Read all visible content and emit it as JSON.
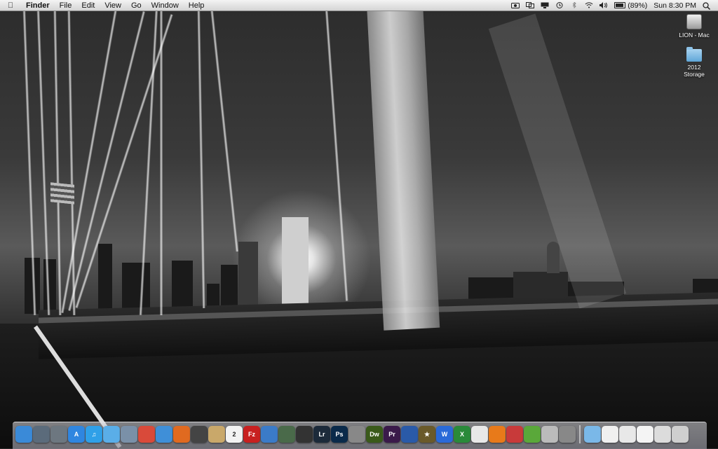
{
  "menubar": {
    "apple_icon": "apple-icon",
    "app_name": "Finder",
    "menus": [
      "File",
      "Edit",
      "View",
      "Go",
      "Window",
      "Help"
    ],
    "battery_text": "(89%)",
    "battery_level": 0.89,
    "clock": "Sun 8:30 PM"
  },
  "desktop_icons": [
    {
      "label_line1": "LION - Mac",
      "label_line2": "",
      "icon": "hard-drive-icon"
    },
    {
      "label_line1": "2012",
      "label_line2": "Storage",
      "icon": "folder-icon"
    }
  ],
  "dock": {
    "items": [
      {
        "name": "finder",
        "icon": "finder-icon",
        "color": "#3a8ad8",
        "glyph": ""
      },
      {
        "name": "dashboard",
        "icon": "dashboard-icon",
        "color": "#5b6b7b",
        "glyph": ""
      },
      {
        "name": "launchpad",
        "icon": "launchpad-icon",
        "color": "#6d7780",
        "glyph": ""
      },
      {
        "name": "app-store",
        "icon": "app-store-icon",
        "color": "#2f86e0",
        "glyph": "A"
      },
      {
        "name": "itunes",
        "icon": "itunes-icon",
        "color": "#2fa0e8",
        "glyph": "♫"
      },
      {
        "name": "messages",
        "icon": "messages-icon",
        "color": "#5aaee8",
        "glyph": ""
      },
      {
        "name": "preview",
        "icon": "preview-icon",
        "color": "#7a90a8",
        "glyph": ""
      },
      {
        "name": "chrome",
        "icon": "chrome-icon",
        "color": "#d94a3a",
        "glyph": ""
      },
      {
        "name": "safari",
        "icon": "safari-icon",
        "color": "#3f8fd8",
        "glyph": ""
      },
      {
        "name": "firefox",
        "icon": "firefox-icon",
        "color": "#e06a20",
        "glyph": ""
      },
      {
        "name": "facetime",
        "icon": "camera-icon",
        "color": "#444",
        "glyph": ""
      },
      {
        "name": "contacts",
        "icon": "address-book-icon",
        "color": "#c9a86a",
        "glyph": ""
      },
      {
        "name": "calendar",
        "icon": "calendar-icon",
        "color": "#f2f2f2",
        "glyph": "2"
      },
      {
        "name": "filezilla",
        "icon": "filezilla-icon",
        "color": "#c82020",
        "glyph": "Fz"
      },
      {
        "name": "world",
        "icon": "globe-icon",
        "color": "#3b7bc8",
        "glyph": ""
      },
      {
        "name": "iphoto",
        "icon": "iphoto-icon",
        "color": "#4a6a4a",
        "glyph": ""
      },
      {
        "name": "aperture",
        "icon": "aperture-icon",
        "color": "#333",
        "glyph": ""
      },
      {
        "name": "lightroom",
        "icon": "lightroom-icon",
        "color": "#1c2a3a",
        "glyph": "Lr"
      },
      {
        "name": "photoshop",
        "icon": "photoshop-icon",
        "color": "#0a2a4a",
        "glyph": "Ps"
      },
      {
        "name": "screenshot",
        "icon": "camera-icon",
        "color": "#888",
        "glyph": ""
      },
      {
        "name": "dreamweaver",
        "icon": "dreamweaver-icon",
        "color": "#3a5a1a",
        "glyph": "Dw"
      },
      {
        "name": "premiere",
        "icon": "premiere-icon",
        "color": "#3a1a4a",
        "glyph": "Pr"
      },
      {
        "name": "quicktime",
        "icon": "quicktime-icon",
        "color": "#2a5aa8",
        "glyph": ""
      },
      {
        "name": "imovie",
        "icon": "star-icon",
        "color": "#6a5a2a",
        "glyph": "★"
      },
      {
        "name": "word",
        "icon": "word-icon",
        "color": "#2a6ad8",
        "glyph": "W"
      },
      {
        "name": "excel",
        "icon": "excel-icon",
        "color": "#2a8a3a",
        "glyph": "X"
      },
      {
        "name": "textedit",
        "icon": "textedit-icon",
        "color": "#e8e8e8",
        "glyph": ""
      },
      {
        "name": "vlc",
        "icon": "vlc-icon",
        "color": "#e87a1a",
        "glyph": ""
      },
      {
        "name": "parallels",
        "icon": "parallels-icon",
        "color": "#c83a3a",
        "glyph": ""
      },
      {
        "name": "activity",
        "icon": "activity-icon",
        "color": "#5aa83a",
        "glyph": ""
      },
      {
        "name": "calculator",
        "icon": "calculator-icon",
        "color": "#bbb",
        "glyph": ""
      },
      {
        "name": "system-preferences",
        "icon": "gear-icon",
        "color": "#888",
        "glyph": ""
      }
    ],
    "right_items": [
      {
        "name": "applications",
        "icon": "folder-icon",
        "color": "#7ab8e8"
      },
      {
        "name": "documents",
        "icon": "document-icon",
        "color": "#f0f0f0"
      },
      {
        "name": "downloads",
        "icon": "document-icon",
        "color": "#e8e8e8"
      },
      {
        "name": "stack-1",
        "icon": "document-icon",
        "color": "#f4f4f4"
      },
      {
        "name": "stack-2",
        "icon": "document-icon",
        "color": "#dcdcdc"
      },
      {
        "name": "trash",
        "icon": "trash-icon",
        "color": "#cfcfcf"
      }
    ]
  }
}
